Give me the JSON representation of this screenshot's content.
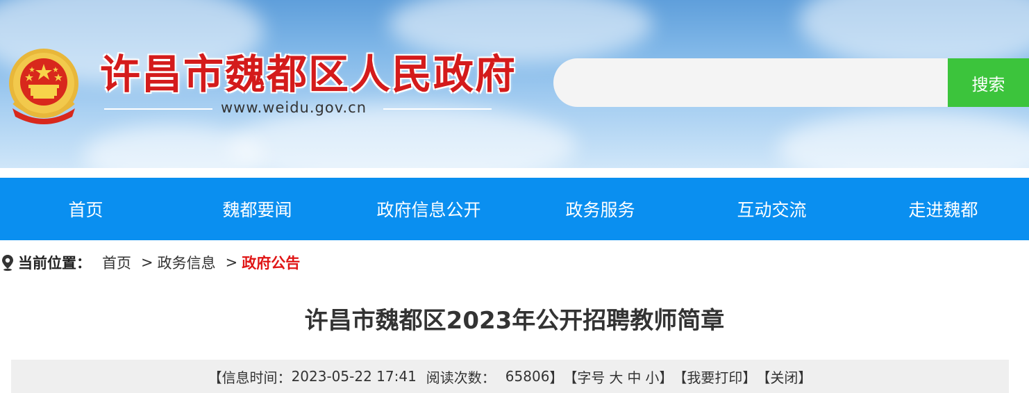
{
  "header": {
    "site_title": "许昌市魏都区人民政府",
    "site_url": "www.weidu.gov.cn",
    "search": {
      "placeholder": "",
      "button_label": "搜索"
    }
  },
  "nav": {
    "items": [
      {
        "label": "首页"
      },
      {
        "label": "魏都要闻"
      },
      {
        "label": "政府信息公开"
      },
      {
        "label": "政务服务"
      },
      {
        "label": "互动交流"
      },
      {
        "label": "走进魏都"
      }
    ]
  },
  "breadcrumb": {
    "label": "当前位置：",
    "items": [
      "首页",
      "政务信息",
      "政府公告"
    ],
    "separator": ">"
  },
  "article": {
    "title": "许昌市魏都区2023年公开招聘教师简章",
    "meta": {
      "open_bracket": "【",
      "time_label": "信息时间：",
      "time_value": "2023-05-22 17:41",
      "views_label": "阅读次数：",
      "views_value": "65806",
      "close_bracket": "】",
      "font_size_label": "【字号",
      "font_large": "大",
      "font_medium": "中",
      "font_small": "小】",
      "print_label": "【我要打印】",
      "close_label": "【关闭】"
    }
  },
  "colors": {
    "nav_bg": "#0a8ff0",
    "search_button": "#3cc43c",
    "title_red": "#d41b1b",
    "breadcrumb_current": "#e01515"
  },
  "icons": {
    "emblem": "national-emblem-icon",
    "location": "location-pin-icon"
  }
}
